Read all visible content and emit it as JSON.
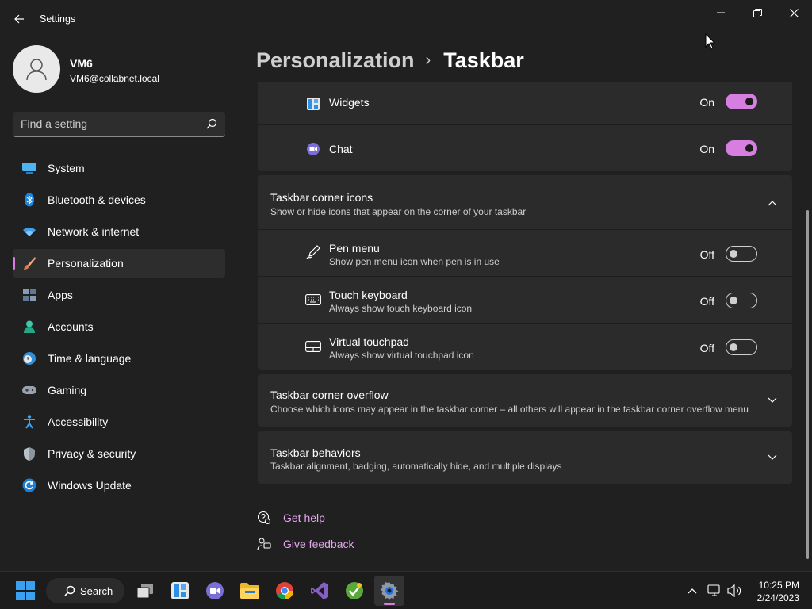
{
  "window": {
    "title": "Settings"
  },
  "profile": {
    "name": "VM6",
    "email": "VM6@collabnet.local"
  },
  "search": {
    "placeholder": "Find a setting"
  },
  "sidebar": {
    "items": [
      {
        "label": "System",
        "icon": "system-icon"
      },
      {
        "label": "Bluetooth & devices",
        "icon": "bluetooth-icon"
      },
      {
        "label": "Network & internet",
        "icon": "wifi-icon"
      },
      {
        "label": "Personalization",
        "icon": "brush-icon",
        "selected": true
      },
      {
        "label": "Apps",
        "icon": "apps-icon"
      },
      {
        "label": "Accounts",
        "icon": "person-icon"
      },
      {
        "label": "Time & language",
        "icon": "clock-globe-icon"
      },
      {
        "label": "Gaming",
        "icon": "gamepad-icon"
      },
      {
        "label": "Accessibility",
        "icon": "accessibility-icon"
      },
      {
        "label": "Privacy & security",
        "icon": "shield-icon"
      },
      {
        "label": "Windows Update",
        "icon": "update-icon"
      }
    ]
  },
  "breadcrumb": {
    "parent": "Personalization",
    "separator": "›",
    "current": "Taskbar"
  },
  "taskbar_items": [
    {
      "label": "Widgets",
      "state": "On",
      "on": true,
      "icon": "widgets-icon"
    },
    {
      "label": "Chat",
      "state": "On",
      "on": true,
      "icon": "chat-icon"
    }
  ],
  "corner_icons": {
    "title": "Taskbar corner icons",
    "subtitle": "Show or hide icons that appear on the corner of your taskbar",
    "expanded": true,
    "items": [
      {
        "label": "Pen menu",
        "sub": "Show pen menu icon when pen is in use",
        "state": "Off",
        "on": false,
        "icon": "pen-icon"
      },
      {
        "label": "Touch keyboard",
        "sub": "Always show touch keyboard icon",
        "state": "Off",
        "on": false,
        "icon": "keyboard-icon"
      },
      {
        "label": "Virtual touchpad",
        "sub": "Always show virtual touchpad icon",
        "state": "Off",
        "on": false,
        "icon": "touchpad-icon"
      }
    ]
  },
  "corner_overflow": {
    "title": "Taskbar corner overflow",
    "subtitle": "Choose which icons may appear in the taskbar corner – all others will appear in the taskbar corner overflow menu"
  },
  "behaviors": {
    "title": "Taskbar behaviors",
    "subtitle": "Taskbar alignment, badging, automatically hide, and multiple displays"
  },
  "links": {
    "help": "Get help",
    "feedback": "Give feedback"
  },
  "taskbar": {
    "search_label": "Search",
    "time": "10:25 PM",
    "date": "2/24/2023"
  },
  "colors": {
    "accent": "#d77ee1",
    "background": "#202020",
    "card": "#2b2b2b"
  }
}
